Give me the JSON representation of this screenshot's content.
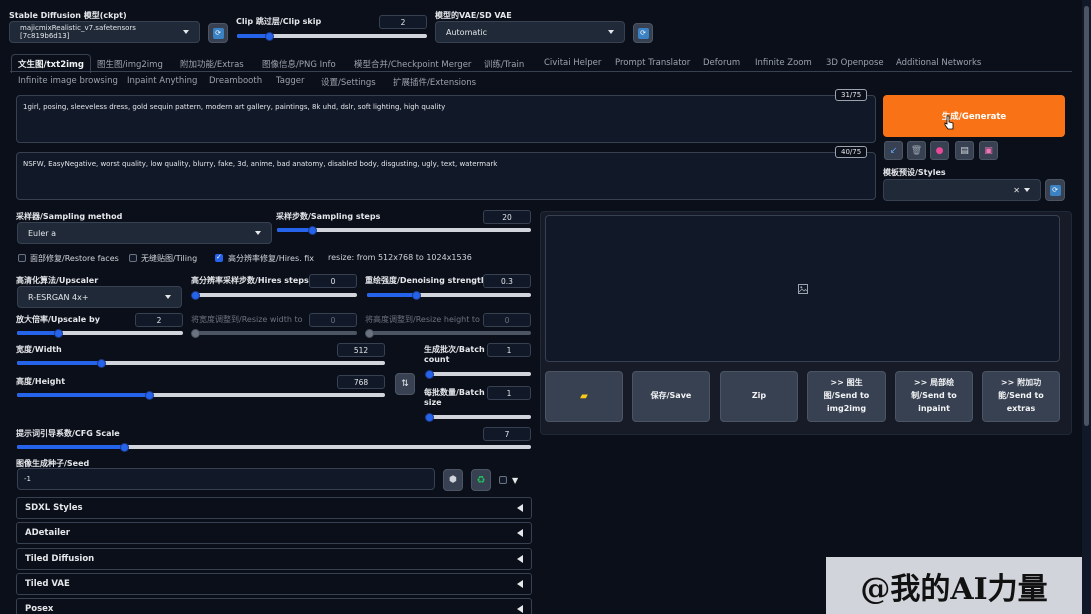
{
  "header": {
    "ckpt_label": "Stable Diffusion 模型(ckpt)",
    "ckpt_value": "majicmixRealistic_v7.safetensors [7c819b6d13]",
    "clip_label": "Clip 跳过层/Clip skip",
    "clip_value": "2",
    "clip_fraction": 0.17,
    "vae_label": "模型的VAE/SD VAE",
    "vae_value": "Automatic"
  },
  "tabs_row1": [
    "文生图/txt2img",
    "图生图/img2img",
    "附加功能/Extras",
    "图像信息/PNG Info",
    "模型合并/Checkpoint Merger",
    "训练/Train",
    "Civitai Helper",
    "Prompt Translator",
    "Deforum",
    "Infinite Zoom",
    "3D Openpose",
    "Additional Networks"
  ],
  "tabs_row2": [
    "Infinite image browsing",
    "Inpaint Anything",
    "Dreambooth",
    "Tagger",
    "设置/Settings",
    "扩展插件/Extensions"
  ],
  "prompt": {
    "text": "1girl, posing, sleeveless dress, gold sequin pattern, modern art gallery, paintings, 8k uhd, dslr, soft lighting, high quality",
    "counter": "31/75"
  },
  "negative_prompt": {
    "text": "NSFW, EasyNegative, worst quality, low quality, blurry, fake, 3d, anime, bad anatomy, disabled body, disgusting, ugly, text, watermark",
    "counter": "40/75"
  },
  "generate_label": "生成/Generate",
  "styles_label": "模板预设/Styles",
  "sampler": {
    "label": "采样器/Sampling method",
    "value": "Euler a"
  },
  "steps": {
    "label": "采样步数/Sampling steps",
    "value": "20",
    "fraction": 0.14
  },
  "checks": {
    "restore_faces": "面部修复/Restore faces",
    "tiling": "无缝贴图/Tiling",
    "hires_fix": "高分辨率修复/Hires. fix",
    "resize_info": "resize: from 512x768 to 1024x1536"
  },
  "upscaler": {
    "label": "高清化算法/Upscaler",
    "value": "R-ESRGAN 4x+"
  },
  "hires_steps": {
    "label": "高分辨率采样步数/Hires steps",
    "value": "0",
    "fraction": 0.0
  },
  "denoise": {
    "label": "重绘强度/Denoising strength",
    "value": "0.3",
    "fraction": 0.3
  },
  "upscale_by": {
    "label": "放大倍率/Upscale by",
    "value": "2",
    "fraction": 0.25
  },
  "resize_w": {
    "label": "将宽度调整到/Resize width to",
    "value": "0",
    "fraction": 0.0
  },
  "resize_h": {
    "label": "将高度调整到/Resize height to",
    "value": "0",
    "fraction": 0.0
  },
  "width": {
    "label": "宽度/Width",
    "value": "512",
    "fraction": 0.23
  },
  "height": {
    "label": "高度/Height",
    "value": "768",
    "fraction": 0.36
  },
  "batch_count": {
    "label1": "生成批次/Batch",
    "label2": "count",
    "value": "1",
    "fraction": 0.0
  },
  "batch_size": {
    "label1": "每批数量/Batch",
    "label2": "size",
    "value": "1",
    "fraction": 0.0
  },
  "cfg": {
    "label": "提示词引导系数/CFG Scale",
    "value": "7",
    "fraction": 0.21
  },
  "seed": {
    "label": "图像生成种子/Seed",
    "value": "-1"
  },
  "accordions": [
    "SDXL Styles",
    "ADetailer",
    "Tiled Diffusion",
    "Tiled VAE",
    "Posex"
  ],
  "output_buttons": {
    "folder_icon": "folder-icon",
    "save": "保存/Save",
    "zip": "Zip",
    "img2img_l1": ">> 图生",
    "img2img_l2": "图/Send to",
    "img2img_l3": "img2img",
    "inpaint_l1": ">> 局部绘",
    "inpaint_l2": "制/Send to",
    "inpaint_l3": "inpaint",
    "extras_l1": ">> 附加功",
    "extras_l2": "能/Send to",
    "extras_l3": "extras"
  },
  "watermark": "@我的AI力量",
  "colors": {
    "accent": "#f97316",
    "primary": "#2563eb",
    "background": "#0b0f19"
  }
}
